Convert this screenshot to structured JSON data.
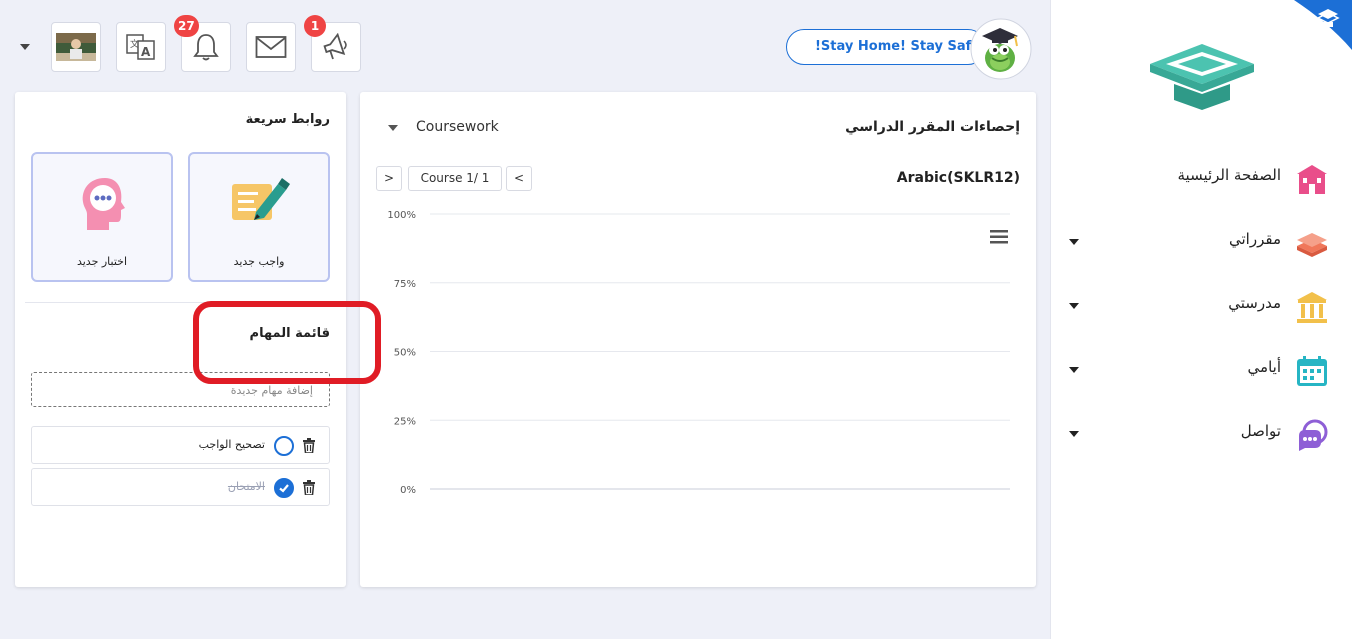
{
  "header": {
    "badges": {
      "translate": "27",
      "announcements": "1"
    },
    "stay_safe": "!Stay Home! Stay Safe",
    "icons": [
      "avatar-thumbnail",
      "translate-icon",
      "bell-icon",
      "envelope-icon",
      "megaphone-icon"
    ]
  },
  "sidebar": {
    "items": [
      {
        "label": "الصفحة الرئيسية",
        "icon": "school-icon",
        "color": "#e94e8a",
        "has_caret": false
      },
      {
        "label": "مقرراتي",
        "icon": "books-icon",
        "color": "#f0775a",
        "has_caret": true
      },
      {
        "label": "مدرستي",
        "icon": "columns-building-icon",
        "color": "#f2c04a",
        "has_caret": true
      },
      {
        "label": "أيامي",
        "icon": "calendar-icon",
        "color": "#26b5c4",
        "has_caret": true
      },
      {
        "label": "تواصل",
        "icon": "chat-icon",
        "color": "#8e5fd6",
        "has_caret": true
      }
    ]
  },
  "stats": {
    "title": "إحصاءات المقرر الدراسي",
    "select_value": "Coursework",
    "course_name": "Arabic(SKLR12)",
    "pager_label": "Course 1/ 1",
    "pager_prev": "<",
    "pager_next": ">"
  },
  "chart_data": {
    "type": "bar",
    "categories": [],
    "values": [],
    "ylim": [
      0,
      100
    ],
    "y_ticks": [
      "100%",
      "75%",
      "50%",
      "25%",
      "0%"
    ],
    "grid": true
  },
  "quick_links": {
    "title": "روابط سريعة",
    "items": [
      {
        "label": "واجب جديد",
        "icon": "homework-pen-icon"
      },
      {
        "label": "اختبار جديد",
        "icon": "thinking-head-icon"
      }
    ]
  },
  "todo": {
    "title": "قائمة المهام",
    "add_placeholder": "إضافة مهام جديدة",
    "tasks": [
      {
        "text": "تصحيح الواجب",
        "done": false
      },
      {
        "text": "الامتحان",
        "done": true
      }
    ]
  },
  "colors": {
    "accent": "#1c6fd6",
    "highlight": "#e01c25",
    "badge": "#ef4444"
  }
}
